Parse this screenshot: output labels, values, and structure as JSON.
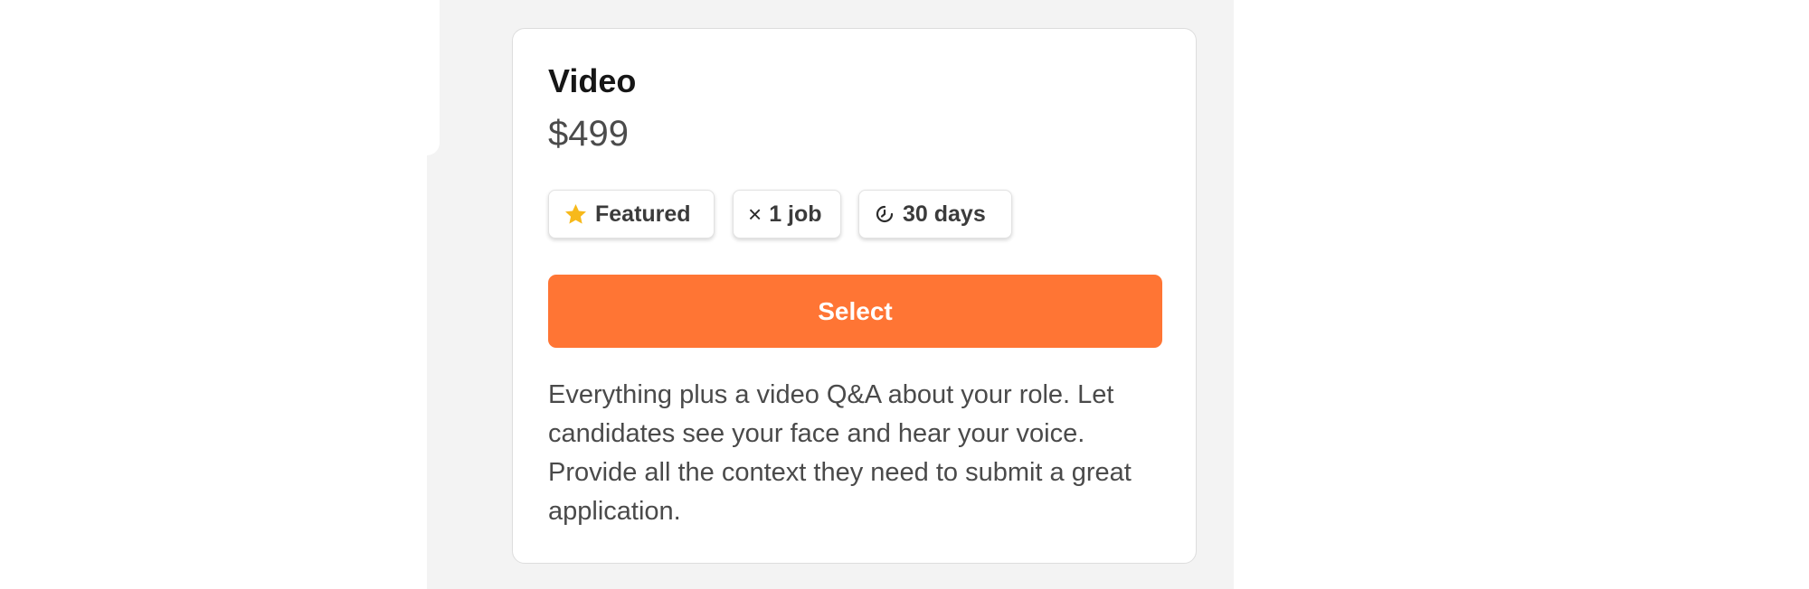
{
  "colors": {
    "page_background": "#ffffff",
    "panel_background": "#f3f3f3",
    "card_background": "#ffffff",
    "card_border": "#dddddd",
    "accent": "#ff7534",
    "star": "#f7b91b",
    "title_text": "#161616",
    "body_text": "#4a4a4a"
  },
  "plan": {
    "title": "Video",
    "price": "$499",
    "badges": {
      "featured": {
        "icon": "star-icon",
        "label": "Featured"
      },
      "jobs": {
        "icon": "close-icon",
        "label": "1 job"
      },
      "duration": {
        "icon": "clock-icon",
        "label": "30 days"
      }
    },
    "select_label": "Select",
    "description": "Everything plus a video Q&A about your role. Let candidates see your face and hear your voice. Provide all the context they need to submit a great application."
  }
}
